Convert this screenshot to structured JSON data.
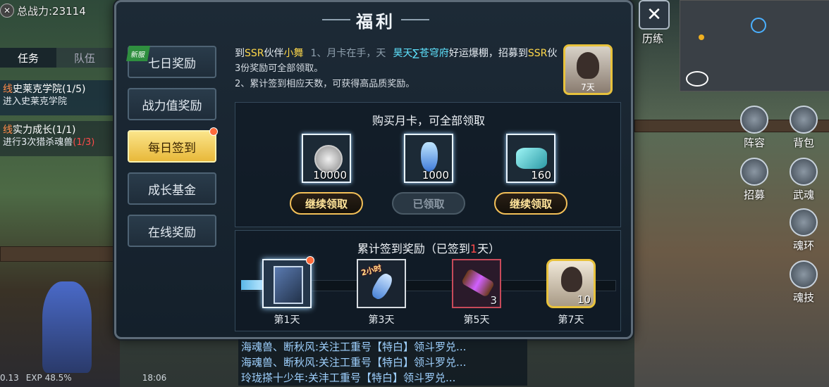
{
  "hud": {
    "power_icon": "crossed-swords-icon",
    "power_label": "总战力:23114",
    "tabs": [
      "任务",
      "队伍"
    ],
    "quests": [
      {
        "tag": "线",
        "title": "史莱克学院(1/5)",
        "desc": "进入史莱克学院",
        "desc_red": ""
      },
      {
        "tag": "线",
        "title": "实力成长(1/1)",
        "desc": "进行3次猎杀魂兽",
        "desc_red": "(1/3)"
      }
    ],
    "level": "0.13",
    "exp": "EXP 48.5%",
    "time": "18:06"
  },
  "dialog": {
    "title": "福利",
    "sidebar": [
      {
        "label": "七日奖励",
        "badge": "新服",
        "active": false,
        "dot": false
      },
      {
        "label": "战力值奖励",
        "badge": "",
        "active": false,
        "dot": false
      },
      {
        "label": "每日签到",
        "badge": "",
        "active": true,
        "dot": true
      },
      {
        "label": "成长基金",
        "badge": "",
        "active": false,
        "dot": false
      },
      {
        "label": "在线奖励",
        "badge": "",
        "active": false,
        "dot": false
      }
    ],
    "ticker": {
      "part1_pre": "到",
      "part1_ssr": "SSR",
      "part1_mid": "伙伴",
      "part1_name": "小舞",
      "part1_rest": "1、月卡在手，天",
      "part2_name": "昊天∑苍穹府",
      "part2_rest": "好运爆棚，招募到",
      "part2_ssr": "SSR",
      "part2_tail": "伙"
    },
    "rules": [
      "3份奖励可全部领取。",
      "2、累计签到相应天数，可获得高品质奖励。"
    ],
    "portrait_label": "7天",
    "monthly": {
      "title": "购买月卡，可全部领取",
      "items": [
        {
          "icon": "silver-coin-icon",
          "qty": "10000",
          "button": "继续领取",
          "state": "on"
        },
        {
          "icon": "potion-icon",
          "qty": "1000",
          "button": "已领取",
          "state": "off"
        },
        {
          "icon": "crystal-icon",
          "qty": "160",
          "button": "继续领取",
          "state": "on"
        }
      ]
    },
    "cumulative": {
      "title_pre": "累计签到奖励（已签到",
      "days": "1",
      "title_post": "天）",
      "progress": 0.06,
      "rewards": [
        {
          "label": "第1天",
          "icon": "card-pack-icon",
          "qty": "",
          "dot": true
        },
        {
          "label": "第3天",
          "icon": "potion-2h-icon",
          "qty": "",
          "tag": "2小时",
          "dot": false
        },
        {
          "label": "第5天",
          "icon": "purple-scroll-icon",
          "qty": "3",
          "dot": false
        },
        {
          "label": "第7天",
          "icon": "ssr-character-icon",
          "qty": "10",
          "dot": false
        }
      ]
    }
  },
  "right_hud": {
    "close": "✕",
    "buttons": [
      "历练",
      "阵容",
      "背包",
      "招募",
      "武魂",
      "魂环",
      "魂技"
    ]
  },
  "chat": [
    "海魂兽、断秋风:关注工重号【特白】领斗罗兑...",
    "海魂兽、断秋风:关注工重号【特白】领斗罗兑...",
    "玲珑搽十少年:关沣工重号【特白】领斗罗兑..."
  ]
}
